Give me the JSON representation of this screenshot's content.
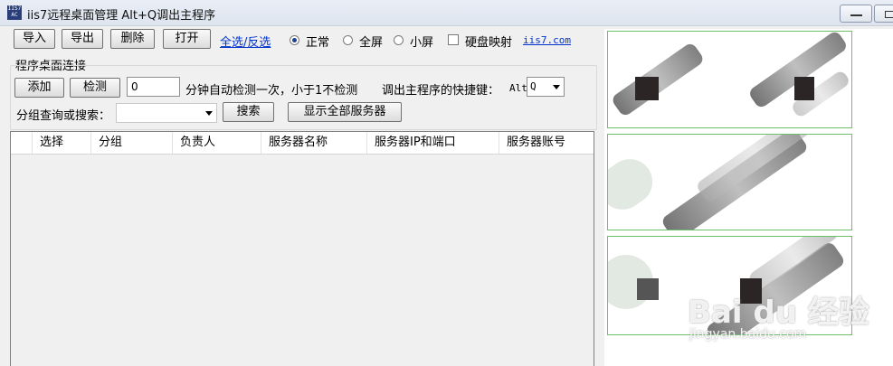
{
  "window": {
    "title": "iis7远程桌面管理 Alt+Q调出主程序",
    "icon_text": "IIS7 AC"
  },
  "toolbar": {
    "import_label": "导入",
    "export_label": "导出",
    "delete_label": "删除",
    "open_label": "打开",
    "select_all_link": "全选/反选",
    "mode_options": [
      {
        "label": "正常",
        "checked": true
      },
      {
        "label": "全屏",
        "checked": false
      },
      {
        "label": "小屏",
        "checked": false
      }
    ],
    "disk_mapping_label": "硬盘映射",
    "disk_mapping_checked": false,
    "site_link": "iis7.com"
  },
  "connection": {
    "group_title": "程序桌面连接",
    "add_label": "添加",
    "check_label": "检测",
    "interval_value": "0",
    "interval_text": "分钟自动检测一次，小于1不检测",
    "hotkey_label": "调出主程序的快捷键：",
    "hotkey_prefix": "Alt+",
    "hotkey_value": "Q",
    "search_label": "分组查询或搜索：",
    "search_value": "",
    "search_button": "搜索",
    "show_all_button": "显示全部服务器"
  },
  "table": {
    "columns": [
      "选择",
      "分组",
      "负责人",
      "服务器名称",
      "服务器IP和端口",
      "服务器账号"
    ],
    "rows": []
  },
  "watermark": {
    "main": "Bai du 经验",
    "sub": "jingyan.baidu.com"
  },
  "colors": {
    "link": "#0033cc",
    "thumb_border": "#6cc06c",
    "background": "#f0f0f0"
  }
}
